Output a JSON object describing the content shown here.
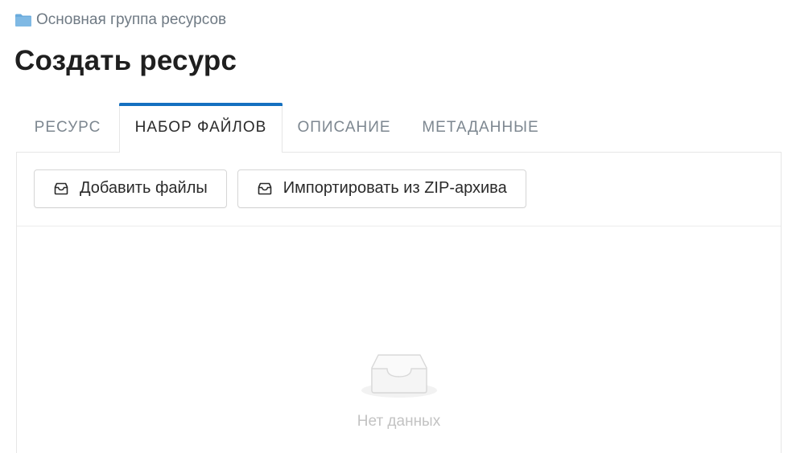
{
  "breadcrumb": {
    "icon": "folder-icon",
    "label": "Основная группа ресурсов"
  },
  "page_title": "Создать ресурс",
  "tabs": [
    {
      "label": "РЕСУРС",
      "active": false
    },
    {
      "label": "НАБОР ФАЙЛОВ",
      "active": true
    },
    {
      "label": "ОПИСАНИЕ",
      "active": false
    },
    {
      "label": "МЕТАДАННЫЕ",
      "active": false
    }
  ],
  "toolbar": {
    "add_files_label": "Добавить файлы",
    "add_files_icon": "inbox-icon",
    "import_zip_label": "Импортировать из ZIP-архива",
    "import_zip_icon": "inbox-icon"
  },
  "empty_state": {
    "icon": "empty-tray-icon",
    "text": "Нет данных"
  },
  "colors": {
    "accent": "#1570c0",
    "folder": "#6aabdc",
    "muted_text": "#7d8790",
    "empty_text": "#c3c3c3"
  }
}
